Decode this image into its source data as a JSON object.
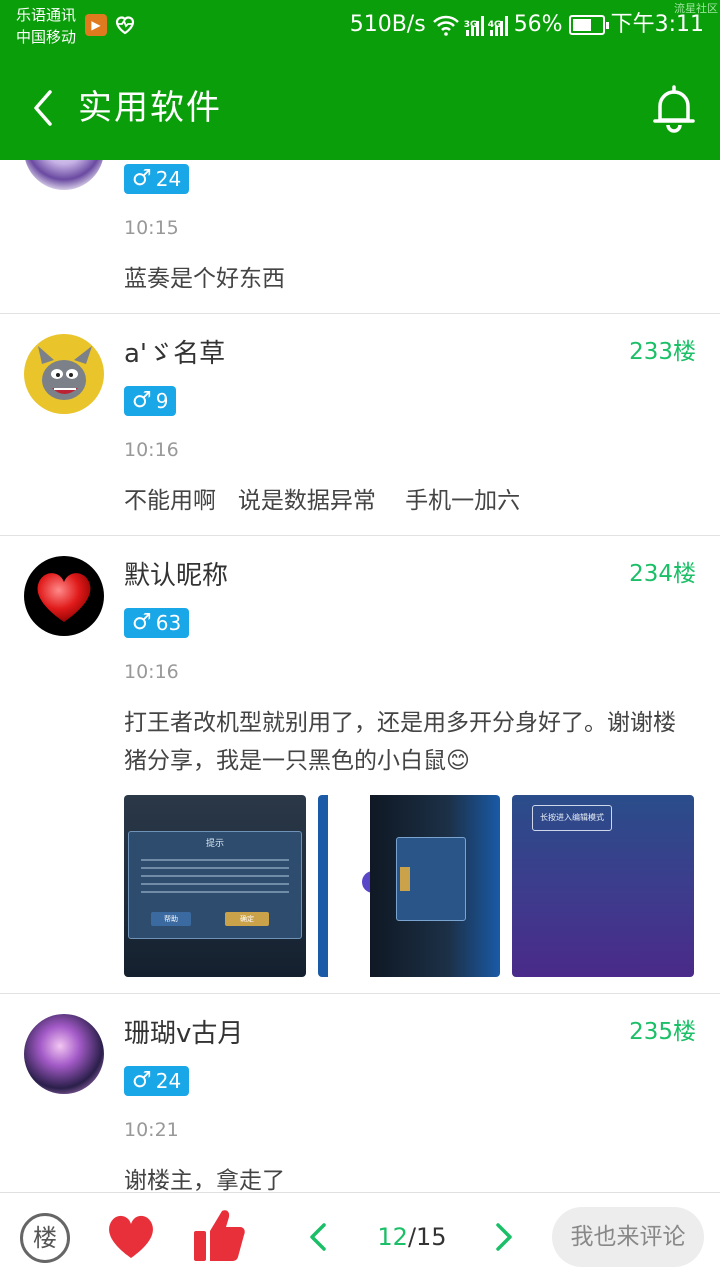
{
  "status_bar": {
    "carrier_line1": "乐语通讯",
    "carrier_line2": "中国移动",
    "net_speed": "510B/s",
    "net1": "3G",
    "net2": "4G",
    "battery": "56%",
    "time": "下午3:11",
    "corner_tag": "流星社区"
  },
  "app_bar": {
    "title": "实用软件",
    "back_icon": "chevron-left-icon",
    "bell_icon": "bell-icon"
  },
  "posts": [
    {
      "nick": "",
      "floor": "",
      "gender": "♂",
      "level": "24",
      "time": "10:15",
      "content": "蓝奏是个好东西"
    },
    {
      "nick": "a'ゞ名草",
      "floor": "233楼",
      "gender": "♂",
      "level": "9",
      "time": "10:16",
      "content": "不能用啊   说是数据异常    手机一加六"
    },
    {
      "nick": "默认昵称",
      "floor": "234楼",
      "gender": "♂",
      "level": "63",
      "time": "10:16",
      "content": "打王者改机型就别用了，还是用多开分身好了。谢谢楼猪分享，我是一只黑色的小白鼠😊",
      "images": [
        {
          "dialog_title": "提示",
          "btn1": "帮助",
          "btn2": "确定"
        },
        {},
        {
          "tooltip": "长按进入编辑模式"
        }
      ]
    },
    {
      "nick": "珊瑚v古月",
      "floor": "235楼",
      "gender": "♂",
      "level": "24",
      "time": "10:21",
      "content": "谢楼主，拿走了"
    }
  ],
  "bottom_bar": {
    "floor_label": "楼",
    "page_current": "12",
    "page_total": "/15",
    "comment_placeholder": "我也来评论"
  },
  "colors": {
    "primary_green": "#0a9f0a",
    "floor_green": "#1bbf67",
    "badge_blue": "#1aa7e8",
    "like_red": "#e8303a"
  }
}
